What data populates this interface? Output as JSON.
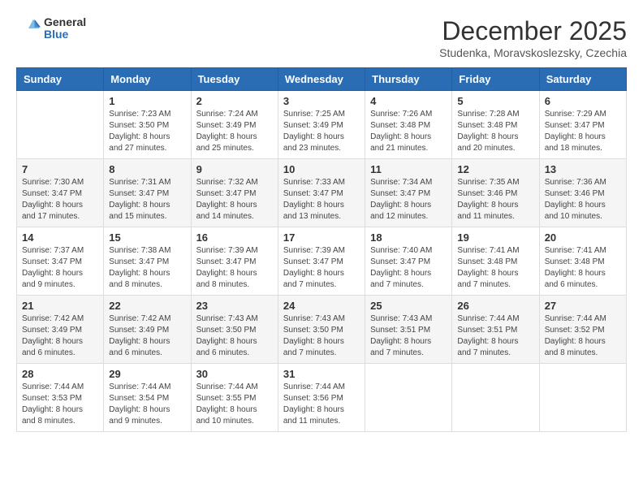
{
  "header": {
    "logo_general": "General",
    "logo_blue": "Blue",
    "month_title": "December 2025",
    "location": "Studenka, Moravskoslezsky, Czechia"
  },
  "weekdays": [
    "Sunday",
    "Monday",
    "Tuesday",
    "Wednesday",
    "Thursday",
    "Friday",
    "Saturday"
  ],
  "weeks": [
    [
      {
        "day": "",
        "sunrise": "",
        "sunset": "",
        "daylight": ""
      },
      {
        "day": "1",
        "sunrise": "7:23 AM",
        "sunset": "3:50 PM",
        "daylight": "8 hours and 27 minutes."
      },
      {
        "day": "2",
        "sunrise": "7:24 AM",
        "sunset": "3:49 PM",
        "daylight": "8 hours and 25 minutes."
      },
      {
        "day": "3",
        "sunrise": "7:25 AM",
        "sunset": "3:49 PM",
        "daylight": "8 hours and 23 minutes."
      },
      {
        "day": "4",
        "sunrise": "7:26 AM",
        "sunset": "3:48 PM",
        "daylight": "8 hours and 21 minutes."
      },
      {
        "day": "5",
        "sunrise": "7:28 AM",
        "sunset": "3:48 PM",
        "daylight": "8 hours and 20 minutes."
      },
      {
        "day": "6",
        "sunrise": "7:29 AM",
        "sunset": "3:47 PM",
        "daylight": "8 hours and 18 minutes."
      }
    ],
    [
      {
        "day": "7",
        "sunrise": "7:30 AM",
        "sunset": "3:47 PM",
        "daylight": "8 hours and 17 minutes."
      },
      {
        "day": "8",
        "sunrise": "7:31 AM",
        "sunset": "3:47 PM",
        "daylight": "8 hours and 15 minutes."
      },
      {
        "day": "9",
        "sunrise": "7:32 AM",
        "sunset": "3:47 PM",
        "daylight": "8 hours and 14 minutes."
      },
      {
        "day": "10",
        "sunrise": "7:33 AM",
        "sunset": "3:47 PM",
        "daylight": "8 hours and 13 minutes."
      },
      {
        "day": "11",
        "sunrise": "7:34 AM",
        "sunset": "3:47 PM",
        "daylight": "8 hours and 12 minutes."
      },
      {
        "day": "12",
        "sunrise": "7:35 AM",
        "sunset": "3:46 PM",
        "daylight": "8 hours and 11 minutes."
      },
      {
        "day": "13",
        "sunrise": "7:36 AM",
        "sunset": "3:46 PM",
        "daylight": "8 hours and 10 minutes."
      }
    ],
    [
      {
        "day": "14",
        "sunrise": "7:37 AM",
        "sunset": "3:47 PM",
        "daylight": "8 hours and 9 minutes."
      },
      {
        "day": "15",
        "sunrise": "7:38 AM",
        "sunset": "3:47 PM",
        "daylight": "8 hours and 8 minutes."
      },
      {
        "day": "16",
        "sunrise": "7:39 AM",
        "sunset": "3:47 PM",
        "daylight": "8 hours and 8 minutes."
      },
      {
        "day": "17",
        "sunrise": "7:39 AM",
        "sunset": "3:47 PM",
        "daylight": "8 hours and 7 minutes."
      },
      {
        "day": "18",
        "sunrise": "7:40 AM",
        "sunset": "3:47 PM",
        "daylight": "8 hours and 7 minutes."
      },
      {
        "day": "19",
        "sunrise": "7:41 AM",
        "sunset": "3:48 PM",
        "daylight": "8 hours and 7 minutes."
      },
      {
        "day": "20",
        "sunrise": "7:41 AM",
        "sunset": "3:48 PM",
        "daylight": "8 hours and 6 minutes."
      }
    ],
    [
      {
        "day": "21",
        "sunrise": "7:42 AM",
        "sunset": "3:49 PM",
        "daylight": "8 hours and 6 minutes."
      },
      {
        "day": "22",
        "sunrise": "7:42 AM",
        "sunset": "3:49 PM",
        "daylight": "8 hours and 6 minutes."
      },
      {
        "day": "23",
        "sunrise": "7:43 AM",
        "sunset": "3:50 PM",
        "daylight": "8 hours and 6 minutes."
      },
      {
        "day": "24",
        "sunrise": "7:43 AM",
        "sunset": "3:50 PM",
        "daylight": "8 hours and 7 minutes."
      },
      {
        "day": "25",
        "sunrise": "7:43 AM",
        "sunset": "3:51 PM",
        "daylight": "8 hours and 7 minutes."
      },
      {
        "day": "26",
        "sunrise": "7:44 AM",
        "sunset": "3:51 PM",
        "daylight": "8 hours and 7 minutes."
      },
      {
        "day": "27",
        "sunrise": "7:44 AM",
        "sunset": "3:52 PM",
        "daylight": "8 hours and 8 minutes."
      }
    ],
    [
      {
        "day": "28",
        "sunrise": "7:44 AM",
        "sunset": "3:53 PM",
        "daylight": "8 hours and 8 minutes."
      },
      {
        "day": "29",
        "sunrise": "7:44 AM",
        "sunset": "3:54 PM",
        "daylight": "8 hours and 9 minutes."
      },
      {
        "day": "30",
        "sunrise": "7:44 AM",
        "sunset": "3:55 PM",
        "daylight": "8 hours and 10 minutes."
      },
      {
        "day": "31",
        "sunrise": "7:44 AM",
        "sunset": "3:56 PM",
        "daylight": "8 hours and 11 minutes."
      },
      {
        "day": "",
        "sunrise": "",
        "sunset": "",
        "daylight": ""
      },
      {
        "day": "",
        "sunrise": "",
        "sunset": "",
        "daylight": ""
      },
      {
        "day": "",
        "sunrise": "",
        "sunset": "",
        "daylight": ""
      }
    ]
  ]
}
